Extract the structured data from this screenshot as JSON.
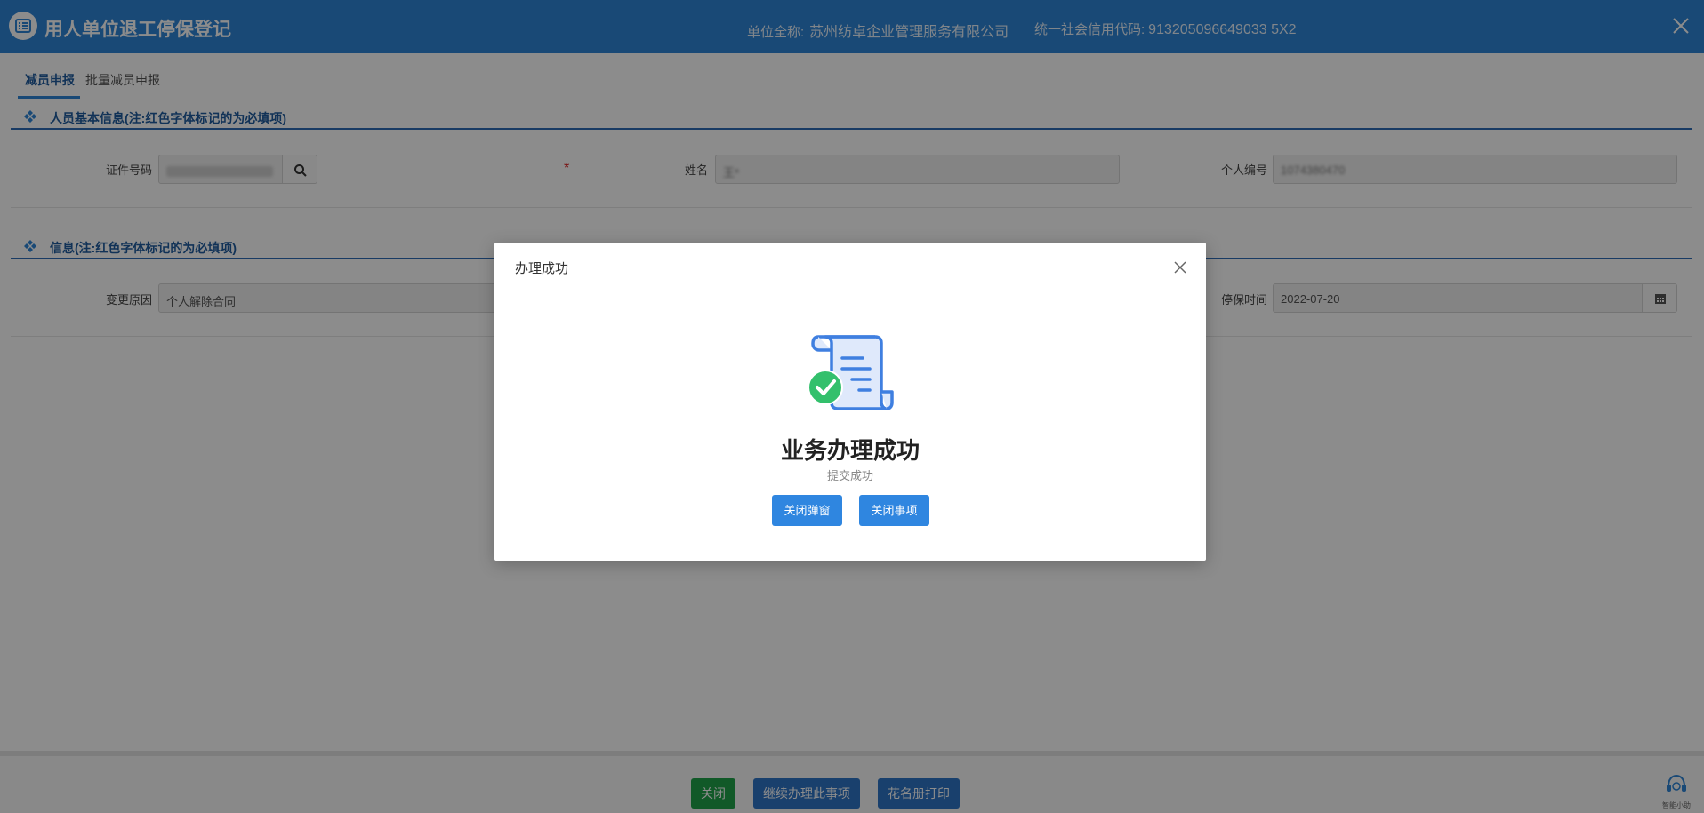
{
  "header": {
    "title": "用人单位退工停保登记",
    "unit_label": "单位全称:",
    "unit_value": "苏州纺卓企业管理服务有限公司",
    "credit_label": "统一社会信用代码:",
    "credit_value": "913205096649033 5X2"
  },
  "tabs": [
    "减员申报",
    "批量减员申报"
  ],
  "section1": {
    "title": "人员基本信息(注:红色字体标记的为必填项)",
    "id_label": "证件号码",
    "name_label": "姓名",
    "name_value": "王*",
    "personal_no_label": "个人编号",
    "personal_no_value": "1074380470",
    "required_mark": "*"
  },
  "section2": {
    "title": "信息(注:红色字体标记的为必填项)",
    "reason_label": "变更原因",
    "reason_value": "个人解除合同",
    "stop_label": "停保时间",
    "stop_value": "2022-07-20"
  },
  "footer": {
    "close_label": "关闭",
    "continue_label": "继续办理此事项",
    "print_label": "花名册打印",
    "assistant_label": "智能小助"
  },
  "modal": {
    "title": "办理成功",
    "headline": "业务办理成功",
    "subtext": "提交成功",
    "close_popup_label": "关闭弹窗",
    "close_item_label": "关闭事项"
  },
  "colors": {
    "header_bg": "#2f86d8",
    "primary_button": "#2f86e0",
    "success_green": "#33c06c",
    "close_button_green": "#1fa34a",
    "footer_button_blue": "#2f75c6"
  },
  "icons": [
    "list-icon",
    "close-icon",
    "search-icon",
    "calendar-icon",
    "diamond-icon",
    "headset-icon",
    "document-success-icon"
  ]
}
